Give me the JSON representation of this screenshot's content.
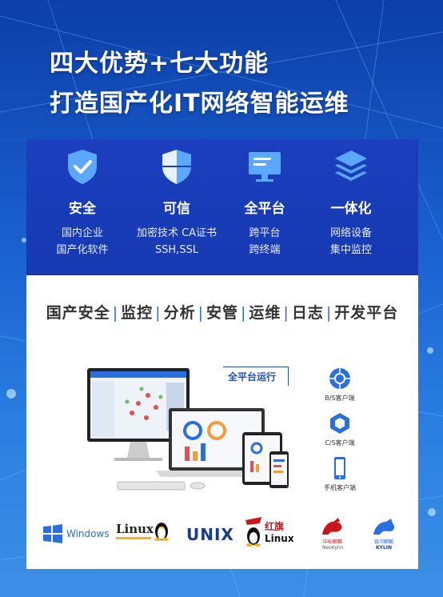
{
  "hero": {
    "line1": "四大优势+七大功能",
    "line2": "打造国产化IT网络智能运维"
  },
  "features": [
    {
      "icon": "shield-check-icon",
      "name": "安全",
      "desc1": "国内企业",
      "desc2": "国产化软件"
    },
    {
      "icon": "shield-half-icon",
      "name": "可信",
      "desc1": "加密技术 CA证书",
      "desc2": "SSH,SSL"
    },
    {
      "icon": "monitor-icon",
      "name": "全平台",
      "desc1": "跨平台",
      "desc2": "跨终端"
    },
    {
      "icon": "layers-icon",
      "name": "一体化",
      "desc1": "网络设备",
      "desc2": "集中监控"
    }
  ],
  "modules": [
    "国产安全",
    "监控",
    "分析",
    "安管",
    "运维",
    "日志",
    "开发平台"
  ],
  "modules_sep": "|",
  "platform_label": "全平台运行",
  "clients": [
    {
      "icon": "browser-client-icon",
      "label": "B/S客户端"
    },
    {
      "icon": "cs-client-icon",
      "label": "C/S客户端"
    },
    {
      "icon": "mobile-client-icon",
      "label": "手机客户端"
    }
  ],
  "logos": {
    "windows": "Windows",
    "linux": "Linux",
    "unix": "UNIX",
    "redflag_cn": "红旗",
    "redflag_linux": "Linux",
    "neokylin_cn": "中标麒麟",
    "neokylin_en": "NeoKylin",
    "kylin_cn": "银河麒麟",
    "kylin_en": "KYLIN"
  },
  "colors": {
    "accent": "#1a4fc9",
    "panel": "#1b3fbf",
    "red": "#c8161d"
  }
}
